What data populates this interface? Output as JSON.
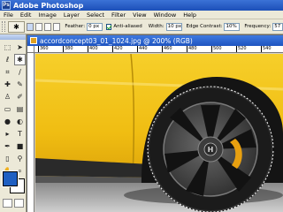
{
  "app": {
    "title": "Adobe Photoshop",
    "icon": "photoshop-logo-icon"
  },
  "menu": [
    "File",
    "Edit",
    "Image",
    "Layer",
    "Select",
    "Filter",
    "View",
    "Window",
    "Help"
  ],
  "options": {
    "tool_icon": "magic-wand-icon",
    "feather_label": "Feather:",
    "feather_value": "0 px",
    "antialiased_label": "Anti-aliased",
    "antialiased_checked": true,
    "width_label": "Width:",
    "width_value": "10 px",
    "edge_contrast_label": "Edge Contrast:",
    "edge_contrast_value": "10%",
    "frequency_label": "Frequency:",
    "frequency_value": "57"
  },
  "document": {
    "title": "accordconcept03_01_1024.jpg @ 200% (RGB)",
    "ruler_ticks": [
      "360",
      "380",
      "400",
      "420",
      "440",
      "460",
      "480",
      "500",
      "520",
      "540"
    ]
  },
  "toolbox": {
    "tools": [
      "rectangular-marquee-icon",
      "move-icon",
      "magnetic-lasso-icon",
      "magic-wand-icon",
      "crop-icon",
      "slice-icon",
      "healing-brush-icon",
      "brush-icon",
      "clone-stamp-icon",
      "history-brush-icon",
      "eraser-icon",
      "gradient-icon",
      "blur-icon",
      "dodge-icon",
      "path-selection-icon",
      "type-icon",
      "pen-icon",
      "shape-icon",
      "notes-icon",
      "eyedropper-icon",
      "hand-icon",
      "zoom-icon"
    ],
    "foreground_color": "#1f5fc2",
    "background_color": "#ffffff"
  },
  "colors": {
    "car_yellow": "#f2c21a",
    "tire": "#1c1c1c",
    "rim": "#4a4a4a",
    "brake_caliper": "#e8a010"
  }
}
